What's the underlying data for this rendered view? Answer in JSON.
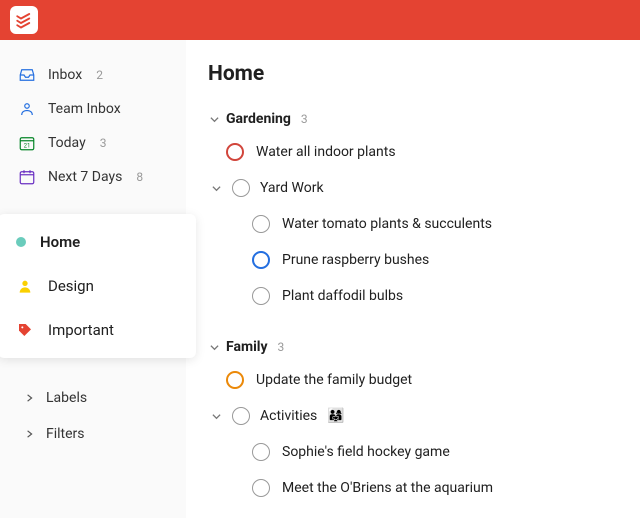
{
  "sidebar": {
    "nav": [
      {
        "label": "Inbox",
        "count": "2",
        "icon": "inbox"
      },
      {
        "label": "Team Inbox",
        "count": "",
        "icon": "team"
      },
      {
        "label": "Today",
        "count": "3",
        "icon": "today"
      },
      {
        "label": "Next 7 Days",
        "count": "8",
        "icon": "week"
      }
    ],
    "projects": [
      {
        "label": "Home",
        "color": "#6accbc",
        "active": true
      },
      {
        "label": "Design",
        "color": "#fad000",
        "active": false
      },
      {
        "label": "Important",
        "color": "#e44332",
        "active": false
      }
    ],
    "filters": [
      {
        "label": "Labels"
      },
      {
        "label": "Filters"
      }
    ]
  },
  "page": {
    "title": "Home"
  },
  "sections": [
    {
      "name": "Gardening",
      "count": "3",
      "tasks": [
        {
          "title": "Water all indoor plants",
          "priority": "p1"
        }
      ],
      "subsection": {
        "name": "Yard Work",
        "emoji": "",
        "tasks": [
          {
            "title": "Water tomato plants & succulents",
            "priority": ""
          },
          {
            "title": "Prune raspberry bushes",
            "priority": "p3"
          },
          {
            "title": "Plant daffodil bulbs",
            "priority": ""
          }
        ]
      }
    },
    {
      "name": "Family",
      "count": "3",
      "tasks": [
        {
          "title": "Update the family budget",
          "priority": "p2"
        }
      ],
      "subsection": {
        "name": "Activities",
        "emoji": "👨‍👩‍👧",
        "tasks": [
          {
            "title": "Sophie's field hockey game",
            "priority": ""
          },
          {
            "title": "Meet the O'Briens at the aquarium",
            "priority": ""
          }
        ]
      }
    }
  ]
}
